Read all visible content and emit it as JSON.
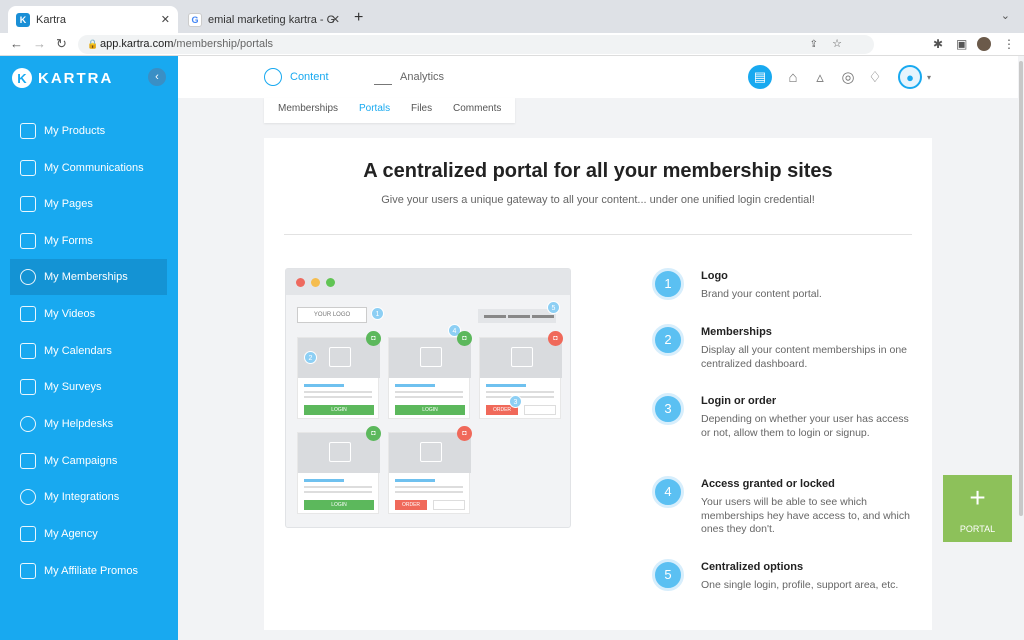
{
  "browser": {
    "tabs": [
      {
        "label": "Kartra",
        "favicon": "kartra-favicon"
      },
      {
        "label": "emial marketing kartra - Googl",
        "favicon": "google-favicon"
      }
    ],
    "url_host": "app.kartra.com",
    "url_path": "/membership/portals"
  },
  "sidebar": {
    "logo": "KARTRA",
    "items": [
      {
        "label": "My Products",
        "icon": "megaphone-icon"
      },
      {
        "label": "My Communications",
        "icon": "people-icon"
      },
      {
        "label": "My Pages",
        "icon": "pages-icon"
      },
      {
        "label": "My Forms",
        "icon": "form-icon"
      },
      {
        "label": "My Memberships",
        "icon": "user-icon",
        "active": true
      },
      {
        "label": "My Videos",
        "icon": "video-icon"
      },
      {
        "label": "My Calendars",
        "icon": "calendar-icon"
      },
      {
        "label": "My Surveys",
        "icon": "check-icon"
      },
      {
        "label": "My Helpdesks",
        "icon": "headset-icon"
      },
      {
        "label": "My Campaigns",
        "icon": "sitemap-icon"
      },
      {
        "label": "My Integrations",
        "icon": "share-icon"
      },
      {
        "label": "My Agency",
        "icon": "building-icon"
      },
      {
        "label": "My Affiliate Promos",
        "icon": "bullhorn-icon"
      }
    ]
  },
  "topnav": {
    "content_label": "Content",
    "analytics_label": "Analytics"
  },
  "subnav": {
    "items": [
      "Memberships",
      "Portals",
      "Files",
      "Comments"
    ],
    "active": "Portals"
  },
  "main": {
    "title": "A centralized portal for all your membership sites",
    "subtitle": "Give your users a unique gateway to all your content... under one unified login credential!",
    "mockup": {
      "logo_text": "YOUR LOGO",
      "login_label": "LOGIN",
      "order_label": "ORDER"
    },
    "features": [
      {
        "num": "1",
        "title": "Logo",
        "desc": "Brand your content portal."
      },
      {
        "num": "2",
        "title": "Memberships",
        "desc": "Display all your content memberships in one centralized dashboard."
      },
      {
        "num": "3",
        "title": "Login or order",
        "desc": "Depending on whether your user has access or not, allow them to login or signup."
      },
      {
        "num": "4",
        "title": "Access granted or locked",
        "desc": "Your users will be able to see which memberships hey have access to, and which ones they don't."
      },
      {
        "num": "5",
        "title": "Centralized options",
        "desc": "One single login, profile, support area, etc."
      }
    ]
  },
  "portal_button": {
    "label": "PORTAL"
  },
  "colors": {
    "brand": "#18a9f0",
    "green": "#8dc15a",
    "login": "#5cb85c",
    "order": "#f0695a"
  }
}
